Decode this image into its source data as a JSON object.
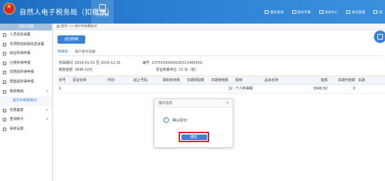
{
  "header": {
    "app_title": "自然人电子税务局（扣缴端）",
    "active_tab_label": "代扣代缴",
    "links": [
      "服务咨询",
      "操作手册",
      "消息中心",
      "单位管理",
      "退"
    ]
  },
  "sidebar": {
    "heading": "代扣代缴",
    "items": [
      {
        "label": "人员信息采集",
        "icon": "person-icon"
      },
      {
        "label": "专项附加扣除信息采集",
        "icon": "list-icon"
      },
      {
        "label": "综合所得申报",
        "icon": "report-icon"
      },
      {
        "label": "分类所得申报",
        "icon": "report-icon"
      },
      {
        "label": "非居民所得申报",
        "icon": "person-icon"
      },
      {
        "label": "限售股所得申报",
        "icon": "chart-icon"
      },
      {
        "label": "税款缴纳",
        "icon": "wallet-icon",
        "expand": "∨"
      },
      {
        "label": "退付手续费核对",
        "sub": true
      },
      {
        "label": "优惠备案",
        "icon": "doc-icon",
        "expand": "∨"
      },
      {
        "label": "查询统计",
        "icon": "search-icon",
        "expand": "∨"
      },
      {
        "label": "系统设置",
        "icon": "gear-icon"
      }
    ]
  },
  "breadcrumb": "首页 >> 退付手续费核对",
  "main": {
    "return_button": "返回明细",
    "tabs": [
      "明细单",
      "单户核对清册"
    ],
    "period_label": "所属期间",
    "period_value": "2019-01-01 至 2019-12-31",
    "id_label": "编号",
    "id_value": "1370103000020031148505S",
    "amount_label": "税款金额",
    "amount_value": "3046.52元",
    "ticket_count_label": "票证数量单位",
    "ticket_count_value": "12 份（枚）"
  },
  "table": {
    "columns": [
      "序号",
      "票证名称",
      "字别",
      "起止号码",
      "期初结存数",
      "本期领取数",
      "本期使用数",
      "税种",
      "品目名称",
      "金额",
      "本期作废数",
      "本期"
    ],
    "rows": [
      [
        "1",
        "",
        "",
        "",
        "",
        "",
        "12",
        "个人所得税",
        "",
        "3046.52",
        "0",
        ""
      ]
    ]
  },
  "modal": {
    "title": "提示信息",
    "close": "×",
    "icon": "i",
    "message": "确认成功!",
    "ok_label": "确定"
  },
  "colors": {
    "brand": "#2f86d8",
    "button": "#3b82d6",
    "highlight_box": "#e02020"
  }
}
